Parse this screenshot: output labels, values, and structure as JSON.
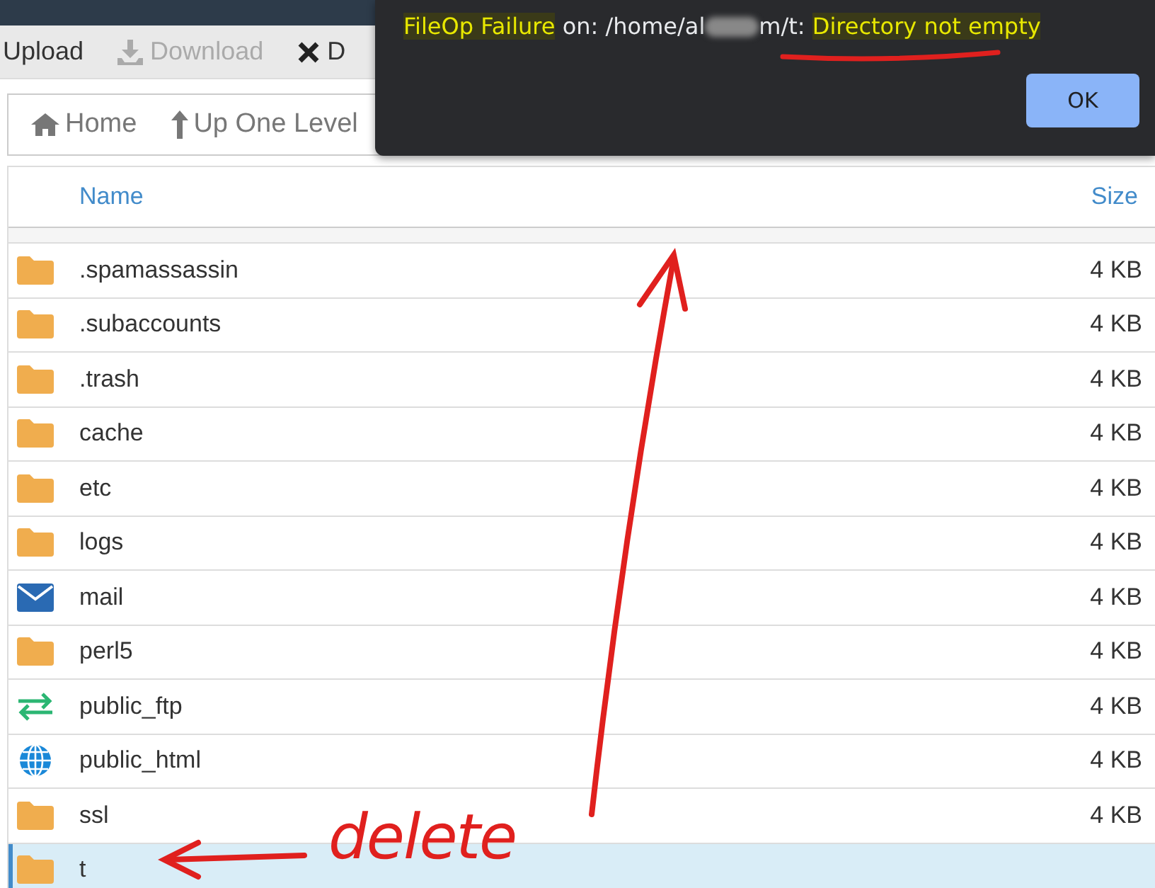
{
  "toolbar": {
    "items": [
      {
        "kind": "upload",
        "label": "Upload",
        "disabled": false
      },
      {
        "kind": "download",
        "label": "Download",
        "disabled": true
      },
      {
        "kind": "delete",
        "label": "D",
        "disabled": false
      }
    ]
  },
  "nav": {
    "items": [
      {
        "kind": "home",
        "label": "Home"
      },
      {
        "kind": "up",
        "label": "Up One Level"
      }
    ]
  },
  "table": {
    "columns": [
      "Name",
      "Size"
    ],
    "rows": [
      {
        "kind": "folder",
        "name": ".spamassassin",
        "size": "4 KB",
        "selected": false
      },
      {
        "kind": "folder",
        "name": ".subaccounts",
        "size": "4 KB",
        "selected": false
      },
      {
        "kind": "folder",
        "name": ".trash",
        "size": "4 KB",
        "selected": false
      },
      {
        "kind": "folder",
        "name": "cache",
        "size": "4 KB",
        "selected": false
      },
      {
        "kind": "folder",
        "name": "etc",
        "size": "4 KB",
        "selected": false
      },
      {
        "kind": "folder",
        "name": "logs",
        "size": "4 KB",
        "selected": false
      },
      {
        "kind": "mail",
        "name": "mail",
        "size": "4 KB",
        "selected": false
      },
      {
        "kind": "folder",
        "name": "perl5",
        "size": "4 KB",
        "selected": false
      },
      {
        "kind": "ftp",
        "name": "public_ftp",
        "size": "4 KB",
        "selected": false
      },
      {
        "kind": "web",
        "name": "public_html",
        "size": "4 KB",
        "selected": false
      },
      {
        "kind": "folder",
        "name": "ssl",
        "size": "4 KB",
        "selected": false
      },
      {
        "kind": "folder",
        "name": "t",
        "selected": true
      }
    ]
  },
  "dialog": {
    "message": [
      {
        "text": "FileOp Failure",
        "highlight": true
      },
      {
        "text": " on: /home/al",
        "highlight": false
      },
      {
        "kind": "blur"
      },
      {
        "text": "m/t: ",
        "highlight": false
      },
      {
        "text": "Directory not empty",
        "highlight": true
      }
    ],
    "button": "OK"
  },
  "annotation": {
    "text": "delete"
  }
}
